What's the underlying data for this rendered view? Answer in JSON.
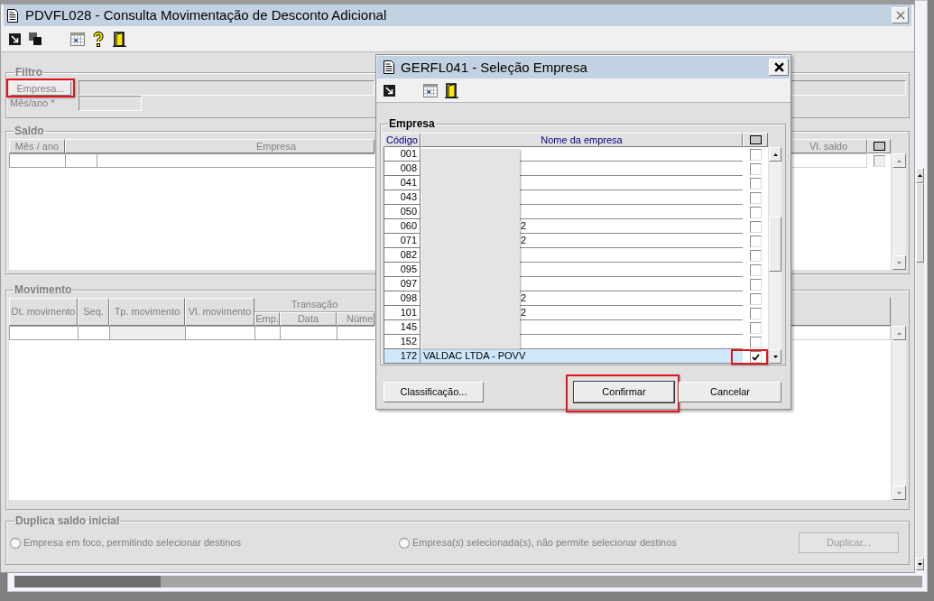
{
  "main_window": {
    "title": "PDVFL028 - Consulta Movimentação de Desconto Adicional",
    "disabled": true,
    "filter": {
      "title": "Filtro",
      "company_button": {
        "label": "Empresa...",
        "highlighted": true
      },
      "month_label": "Mês/ano *"
    },
    "balance": {
      "title": "Saldo",
      "columns": [
        "Mês / ano",
        "Empresa",
        "Vl. saldo"
      ],
      "row_checked": false
    },
    "movement": {
      "title": "Movimento",
      "columns": [
        "Dt. movimento",
        "Seq.",
        "Tp. movimento",
        "Vl. movimento"
      ],
      "group_header": "Transação",
      "sub_columns": [
        "Emp.",
        "Data",
        "Núme"
      ]
    },
    "duplicate": {
      "title": "Duplica saldo inicial",
      "options": [
        {
          "label": "Empresa em foco, permitindo selecionar destinos",
          "selected": false
        },
        {
          "label": "Empresa(s) selecionada(s), não permite selecionar destinos",
          "selected": false
        }
      ],
      "button": {
        "label": "Duplicar...",
        "disabled": true
      }
    }
  },
  "dialog": {
    "title": "GERFL041 - Seleção Empresa",
    "group_title": "Empresa",
    "columns": [
      "Código",
      "Nome da empresa"
    ],
    "rows": [
      {
        "code": "001",
        "redacted": true,
        "checked": false,
        "selected": false,
        "highlighted": false
      },
      {
        "code": "008",
        "redacted": true,
        "checked": false,
        "selected": false,
        "highlighted": false
      },
      {
        "code": "041",
        "redacted": true,
        "checked": false,
        "selected": false,
        "highlighted": false
      },
      {
        "code": "043",
        "redacted": true,
        "checked": false,
        "selected": false,
        "highlighted": false
      },
      {
        "code": "050",
        "redacted": true,
        "checked": false,
        "selected": false,
        "highlighted": false
      },
      {
        "code": "060",
        "redacted": true,
        "name": "2",
        "checked": false,
        "selected": false,
        "highlighted": false
      },
      {
        "code": "071",
        "redacted": true,
        "name": "2",
        "checked": false,
        "selected": false,
        "highlighted": false
      },
      {
        "code": "082",
        "redacted": true,
        "checked": false,
        "selected": false,
        "highlighted": false
      },
      {
        "code": "095",
        "redacted": true,
        "checked": false,
        "selected": false,
        "highlighted": false
      },
      {
        "code": "097",
        "redacted": true,
        "checked": false,
        "selected": false,
        "highlighted": false
      },
      {
        "code": "098",
        "redacted": true,
        "name": "2",
        "checked": false,
        "selected": false,
        "highlighted": false
      },
      {
        "code": "101",
        "redacted": true,
        "name": "2",
        "checked": false,
        "selected": false,
        "highlighted": false
      },
      {
        "code": "145",
        "redacted": true,
        "checked": false,
        "selected": false,
        "highlighted": false
      },
      {
        "code": "152",
        "redacted": true,
        "checked": false,
        "selected": false,
        "highlighted": false
      },
      {
        "code": "172",
        "redacted": false,
        "name": "VALDAC LTDA - POVV",
        "checked": true,
        "selected": true,
        "highlighted": true
      }
    ],
    "buttons": [
      {
        "label": "Classificação...",
        "highlighted": false
      },
      {
        "label": "Confirmar",
        "highlighted": true
      },
      {
        "label": "Cancelar",
        "highlighted": false
      }
    ]
  }
}
